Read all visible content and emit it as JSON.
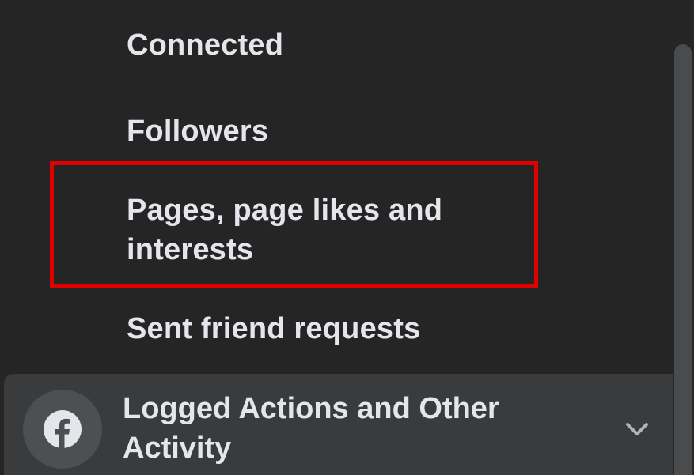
{
  "menu": {
    "items": [
      {
        "label": "Connected"
      },
      {
        "label": "Followers"
      },
      {
        "label": "Pages, page likes and interests"
      },
      {
        "label": "Sent friend requests"
      }
    ]
  },
  "section": {
    "label": "Logged Actions and Other Activity",
    "icon": "facebook-icon",
    "expand_icon": "chevron-down-icon"
  },
  "colors": {
    "background": "#252526",
    "text": "#e4e6eb",
    "highlight": "#e00000",
    "section_bg": "#3a3b3c"
  }
}
